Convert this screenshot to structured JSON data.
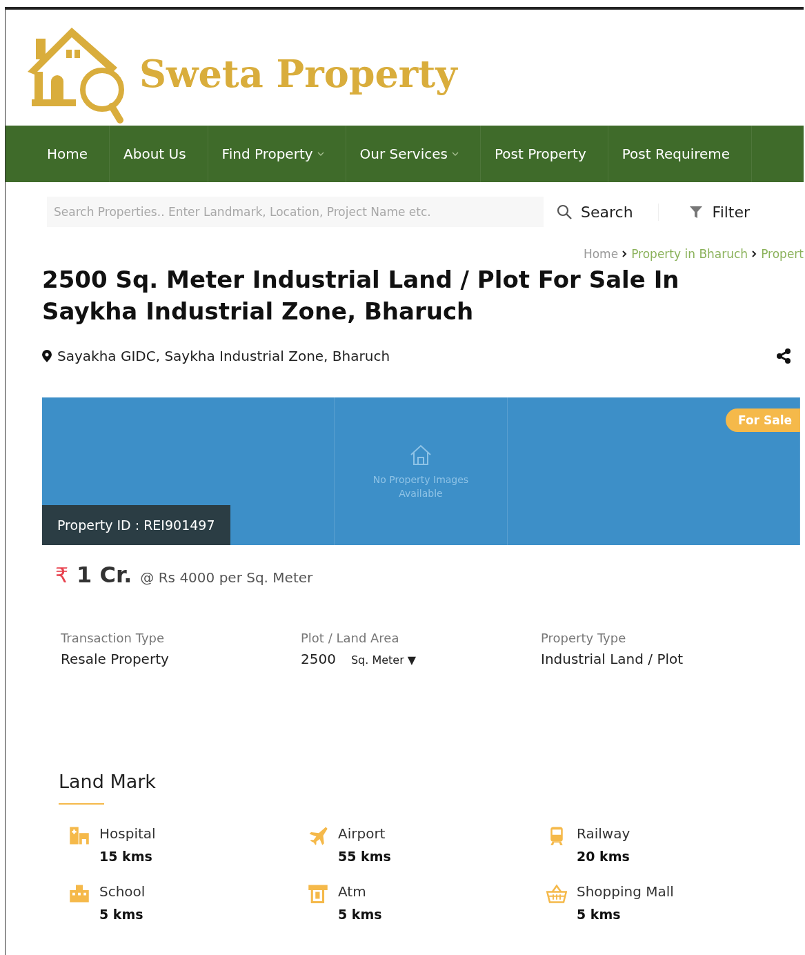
{
  "brand": {
    "name": "Sweta Property"
  },
  "nav": [
    {
      "label": "Home",
      "dropdown": false
    },
    {
      "label": "About Us",
      "dropdown": false
    },
    {
      "label": "Find Property",
      "dropdown": true
    },
    {
      "label": "Our Services",
      "dropdown": true
    },
    {
      "label": "Post Property",
      "dropdown": false
    },
    {
      "label": "Post Requireme",
      "dropdown": false
    }
  ],
  "search": {
    "placeholder": "Search Properties.. Enter Landmark, Location, Project Name etc.",
    "button": "Search",
    "filter": "Filter"
  },
  "breadcrumb": [
    "Home",
    "Property in Bharuch",
    "Propert"
  ],
  "title": "2500 Sq. Meter Industrial Land / Plot For Sale In Saykha Industrial Zone, Bharuch",
  "location": "Sayakha GIDC, Saykha Industrial Zone, Bharuch",
  "gallery": {
    "placeholder": "No Property Images Available",
    "badge": "For Sale",
    "property_id": "Property ID : REI901497"
  },
  "price": {
    "currency": "₹",
    "amount": "1 Cr.",
    "rate": "@ Rs 4000 per Sq. Meter"
  },
  "details": [
    {
      "label": "Transaction Type",
      "value": "Resale Property"
    },
    {
      "label": "Plot / Land Area",
      "value": "2500",
      "unit": "Sq. Meter ▼"
    },
    {
      "label": "Property Type",
      "value": "Industrial Land / Plot"
    }
  ],
  "landmarks_title": "Land Mark",
  "landmarks": [
    {
      "kind": "hospital",
      "name": "Hospital",
      "distance": "15 kms"
    },
    {
      "kind": "airport",
      "name": "Airport",
      "distance": "55 kms"
    },
    {
      "kind": "railway",
      "name": "Railway",
      "distance": "20 kms"
    },
    {
      "kind": "school",
      "name": "School",
      "distance": "5 kms"
    },
    {
      "kind": "atm",
      "name": "Atm",
      "distance": "5 kms"
    },
    {
      "kind": "mall",
      "name": "Shopping Mall",
      "distance": "5 kms"
    }
  ]
}
